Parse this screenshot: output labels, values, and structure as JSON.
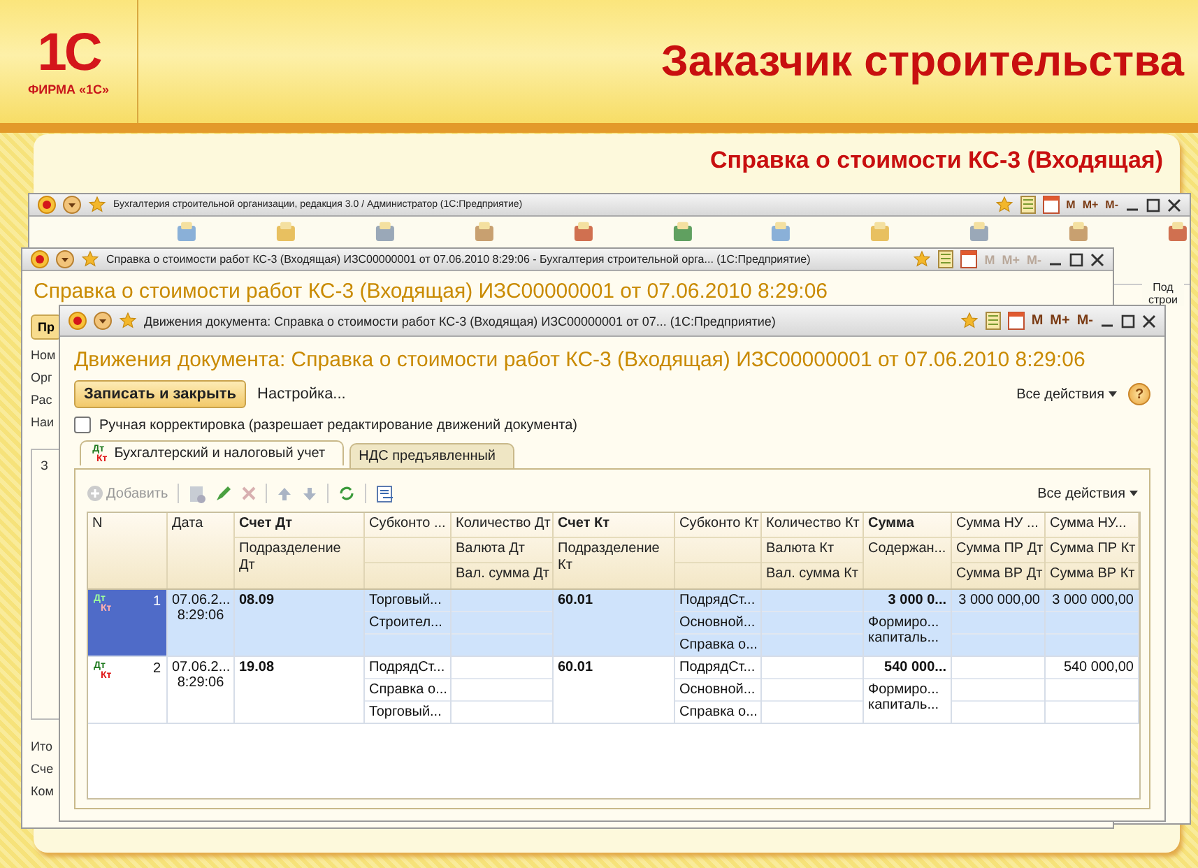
{
  "slide": {
    "logo": "1С",
    "brand": "ФИРМА «1С»",
    "title": "Заказчик строительства",
    "caption": "Справка о стоимости КС-3 (Входящая)"
  },
  "back_window": {
    "title": "Бухгалтерия строительной организации, редакция 3.0 / Администратор  (1С:Предприятие)",
    "memory_buttons": [
      "M",
      "M+",
      "M-"
    ],
    "section_label": "Под строи"
  },
  "document_window": {
    "title": "Справка о стоимости работ КС-3 (Входящая) ИЗС00000001 от 07.06.2010 8:29:06 - Бухгалтерия строительной орга...  (1С:Предприятие)",
    "memory_buttons": [
      "M",
      "M+",
      "M-"
    ],
    "heading": "Справка о стоимости работ КС-3 (Входящая) ИЗС00000001 от 07.06.2010 8:29:06",
    "button": "Пр",
    "field_labels": [
      "Ном",
      "Орг",
      "Рас",
      "Наи"
    ],
    "panel_label": "З",
    "footer_labels": [
      "Ито",
      "Сче",
      "Ком"
    ]
  },
  "movements_window": {
    "title": "Движения документа: Справка о стоимости работ КС-3 (Входящая) ИЗС00000001 от 07...  (1С:Предприятие)",
    "memory_buttons": [
      "M",
      "M+",
      "M-"
    ],
    "heading": "Движения документа: Справка о стоимости работ КС-3 (Входящая) ИЗС00000001 от 07.06.2010 8:29:06",
    "save_button": "Записать и закрыть",
    "settings_link": "Настройка...",
    "all_actions": "Все действия",
    "help": "?",
    "manual_edit": {
      "label": "Ручная корректировка (разрешает редактирование движений документа)",
      "checked": false
    },
    "tabs": [
      {
        "label": "Бухгалтерский и налоговый учет",
        "selected": true,
        "debit": "Дт",
        "credit": "Кт"
      },
      {
        "label": "НДС предъявленный",
        "selected": false
      }
    ],
    "add_button": "Добавить",
    "table_actions": "Все действия",
    "columns": [
      {
        "kind": "number",
        "header": [
          "N"
        ]
      },
      {
        "kind": "plain",
        "header": [
          "Дата"
        ]
      },
      {
        "kind": "account",
        "bold": true,
        "header": [
          "Счет Дт",
          "Подразделение Дт"
        ]
      },
      {
        "kind": "subconto",
        "header": [
          "Субконто ..."
        ]
      },
      {
        "kind": "subconto",
        "header": [
          "Количество Дт",
          "Валюта Дт",
          "Вал. сумма Дт"
        ]
      },
      {
        "kind": "account",
        "bold": true,
        "header": [
          "Счет Кт",
          "Подразделение Кт"
        ]
      },
      {
        "kind": "subconto",
        "header": [
          "Субконто Кт"
        ]
      },
      {
        "kind": "subconto",
        "header": [
          "Количество Кт",
          "Валюта Кт",
          "Вал. сумма Кт"
        ]
      },
      {
        "kind": "sum",
        "bold": true,
        "header": [
          "Сумма",
          "Содержан..."
        ]
      },
      {
        "kind": "amount",
        "header": [
          "Сумма НУ ...",
          "Сумма ПР Дт",
          "Сумма ВР Дт"
        ]
      },
      {
        "kind": "amount",
        "header": [
          "Сумма НУ...",
          "Сумма ПР Кт",
          "Сумма ВР Кт"
        ]
      }
    ],
    "rows": [
      {
        "selected": true,
        "debit": "Дт",
        "credit": "Кт",
        "cells": [
          [
            "1"
          ],
          [
            "07.06.2...",
            "8:29:06"
          ],
          [
            "08.09"
          ],
          [
            "Торговый...",
            "Строител..."
          ],
          [],
          [
            "60.01"
          ],
          [
            "ПодрядСт...",
            "Основной...",
            "Справка о..."
          ],
          [],
          [
            "3 000 0...",
            "Формиро... капиталь..."
          ],
          [
            "3 000 000,00"
          ],
          [
            "3 000 000,00"
          ]
        ]
      },
      {
        "selected": false,
        "debit": "Дт",
        "credit": "Кт",
        "cells": [
          [
            "2"
          ],
          [
            "07.06.2...",
            "8:29:06"
          ],
          [
            "19.08"
          ],
          [
            "ПодрядСт...",
            "Справка о...",
            "Торговый..."
          ],
          [],
          [
            "60.01"
          ],
          [
            "ПодрядСт...",
            "Основной...",
            "Справка о..."
          ],
          [],
          [
            "540 000...",
            "Формиро... капиталь..."
          ],
          [],
          [
            "540 000,00"
          ]
        ]
      }
    ]
  }
}
